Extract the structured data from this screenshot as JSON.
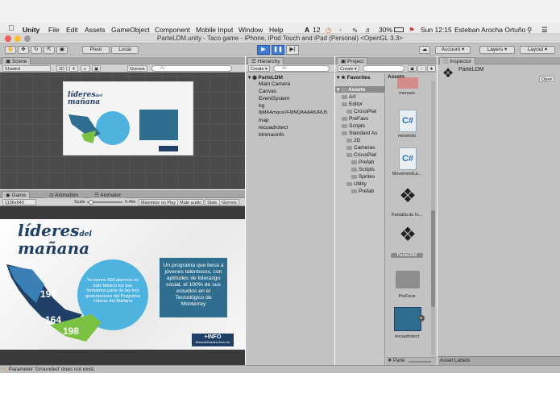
{
  "menubar": {
    "items": [
      "Unity",
      "File",
      "Edit",
      "Assets",
      "GameObject",
      "Component",
      "Mobile Input",
      "Window",
      "Help"
    ],
    "status": {
      "notifications": "12",
      "battery": "30%",
      "clock": "Sun 12:15",
      "user": "Esteban Arocha Ortuño"
    }
  },
  "window": {
    "title": "ParteLDM.unity - Taco game - iPhone, iPod Touch and iPad (Personal) <OpenGL 3.3>"
  },
  "toolbar": {
    "pivot": "Pivot",
    "local": "Local",
    "account": "Account",
    "layers": "Layers",
    "layout": "Layout"
  },
  "scene": {
    "tab": "Scene",
    "shading": "Shaded",
    "mode2d": "2D",
    "gizmos": "Gizmos",
    "search_placeholder": "All"
  },
  "game": {
    "tabs": [
      "Game",
      "Animation",
      "Animator"
    ],
    "resolution": "1136x640",
    "scale_label": "Scale",
    "scale_value": "0.49x",
    "options": [
      "Maximize on Play",
      "Mute audio",
      "Stats",
      "Gizmos"
    ]
  },
  "hierarchy": {
    "tab": "Hierarchy",
    "create": "Create",
    "search_placeholder": "All",
    "scene_name": "ParteLDM",
    "items": [
      "Main Camera",
      "Canvas",
      "EventSystem",
      "bg",
      "8jMAAmqcaVFI8NQAAAA8JRU5",
      "map",
      "recuadrotect",
      "btnmasinfo"
    ]
  },
  "project": {
    "tab": "Project",
    "create": "Create",
    "favorites": "Favorites",
    "assets": "Assets",
    "tree": [
      {
        "label": "Art",
        "indent": 1
      },
      {
        "label": "Editor",
        "indent": 1
      },
      {
        "label": "CrossPlat",
        "indent": 2
      },
      {
        "label": "PreFavs",
        "indent": 1
      },
      {
        "label": "Scripts",
        "indent": 1
      },
      {
        "label": "Standard As",
        "indent": 1
      },
      {
        "label": "2D",
        "indent": 2
      },
      {
        "label": "Cameras",
        "indent": 2
      },
      {
        "label": "CrossPlat",
        "indent": 2
      },
      {
        "label": "Prefab",
        "indent": 3
      },
      {
        "label": "Scripts",
        "indent": 3
      },
      {
        "label": "Sprites",
        "indent": 3
      },
      {
        "label": "Utility",
        "indent": 2
      },
      {
        "label": "Prefab",
        "indent": 3
      }
    ],
    "assets_header": "Assets",
    "asset_items": [
      "menuso",
      "moveinfo",
      "MovementLa...",
      "Pantalla de In...",
      "ParteLDM",
      "PreFavs",
      "recuadrotect"
    ],
    "footer": "Parte"
  },
  "inspector": {
    "tab": "Inspector",
    "object": "ParteLDM",
    "open": "Open",
    "asset_labels": "Asset Labels"
  },
  "slide": {
    "logo_line1": "líderes",
    "logo_del": "del",
    "logo_line2": "mañana",
    "circle_text": "Ya somos 558 alumnos en todo México los que formamos parte de las tres generaciones del Programa Líderes del Mañana",
    "box_text": "Un programa que beca a jóvenes talentosos, con aptitudes de liderazgo social, el 100% de sus estudios en el Tecnológico de Monterrey",
    "num1": "196",
    "num2": "164",
    "num3": "198",
    "info": "+INFO",
    "info_sub": "liderazdelmanana.itesm.mx"
  },
  "status": {
    "message": "Parameter 'Grounded' does not exist."
  },
  "colors": {
    "accent": "#3e7bd6",
    "slide_dark": "#1f3f66",
    "slide_teal": "#2f6e8f",
    "slide_light": "#4fb3e0",
    "map_green": "#7cc242"
  }
}
